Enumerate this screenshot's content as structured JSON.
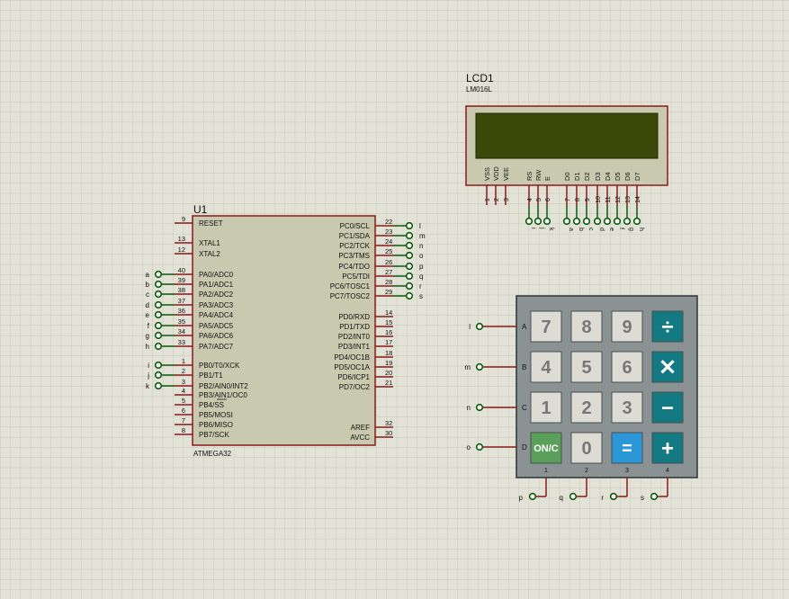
{
  "mcu": {
    "ref": "U1",
    "part": "ATMEGA32",
    "left_pins": [
      {
        "num": "9",
        "name": "RESET",
        "net": ""
      },
      {
        "num": "13",
        "name": "XTAL1",
        "net": ""
      },
      {
        "num": "12",
        "name": "XTAL2",
        "net": ""
      },
      {
        "num": "40",
        "name": "PA0/ADC0",
        "net": "a"
      },
      {
        "num": "39",
        "name": "PA1/ADC1",
        "net": "b"
      },
      {
        "num": "38",
        "name": "PA2/ADC2",
        "net": "c"
      },
      {
        "num": "37",
        "name": "PA3/ADC3",
        "net": "d"
      },
      {
        "num": "36",
        "name": "PA4/ADC4",
        "net": "e"
      },
      {
        "num": "35",
        "name": "PA5/ADC5",
        "net": "f"
      },
      {
        "num": "34",
        "name": "PA6/ADC6",
        "net": "g"
      },
      {
        "num": "33",
        "name": "PA7/ADC7",
        "net": "h"
      },
      {
        "num": "1",
        "name": "PB0/T0/XCK",
        "net": "i"
      },
      {
        "num": "2",
        "name": "PB1/T1",
        "net": "j"
      },
      {
        "num": "3",
        "name": "PB2/AIN0/INT2",
        "net": "k"
      },
      {
        "num": "4",
        "name": "PB3/AIN1/OC0",
        "net": ""
      },
      {
        "num": "5",
        "name": "PB4/SS",
        "net": ""
      },
      {
        "num": "6",
        "name": "PB5/MOSI",
        "net": ""
      },
      {
        "num": "7",
        "name": "PB6/MISO",
        "net": ""
      },
      {
        "num": "8",
        "name": "PB7/SCK",
        "net": ""
      }
    ],
    "right_pins": [
      {
        "num": "22",
        "name": "PC0/SCL",
        "net": "l"
      },
      {
        "num": "23",
        "name": "PC1/SDA",
        "net": "m"
      },
      {
        "num": "24",
        "name": "PC2/TCK",
        "net": "n"
      },
      {
        "num": "25",
        "name": "PC3/TMS",
        "net": "o"
      },
      {
        "num": "26",
        "name": "PC4/TDO",
        "net": "p"
      },
      {
        "num": "27",
        "name": "PC5/TDI",
        "net": "q"
      },
      {
        "num": "28",
        "name": "PC6/TOSC1",
        "net": "r"
      },
      {
        "num": "29",
        "name": "PC7/TOSC2",
        "net": "s"
      },
      {
        "num": "14",
        "name": "PD0/RXD",
        "net": ""
      },
      {
        "num": "15",
        "name": "PD1/TXD",
        "net": ""
      },
      {
        "num": "16",
        "name": "PD2/INT0",
        "net": ""
      },
      {
        "num": "17",
        "name": "PD3/INT1",
        "net": ""
      },
      {
        "num": "18",
        "name": "PD4/OC1B",
        "net": ""
      },
      {
        "num": "19",
        "name": "PD5/OC1A",
        "net": ""
      },
      {
        "num": "20",
        "name": "PD6/ICP1",
        "net": ""
      },
      {
        "num": "21",
        "name": "PD7/OC2",
        "net": ""
      },
      {
        "num": "32",
        "name": "AREF",
        "net": ""
      },
      {
        "num": "30",
        "name": "AVCC",
        "net": ""
      }
    ]
  },
  "lcd": {
    "ref": "LCD1",
    "part": "LM016L",
    "pins": [
      {
        "num": "1",
        "name": "VSS",
        "net": ""
      },
      {
        "num": "2",
        "name": "VDD",
        "net": ""
      },
      {
        "num": "3",
        "name": "VEE",
        "net": ""
      },
      {
        "num": "4",
        "name": "RS",
        "net": "i"
      },
      {
        "num": "5",
        "name": "RW",
        "net": "j"
      },
      {
        "num": "6",
        "name": "E",
        "net": "k"
      },
      {
        "num": "7",
        "name": "D0",
        "net": "a"
      },
      {
        "num": "8",
        "name": "D1",
        "net": "b"
      },
      {
        "num": "9",
        "name": "D2",
        "net": "c"
      },
      {
        "num": "10",
        "name": "D3",
        "net": "d"
      },
      {
        "num": "11",
        "name": "D4",
        "net": "e"
      },
      {
        "num": "12",
        "name": "D5",
        "net": "f"
      },
      {
        "num": "13",
        "name": "D6",
        "net": "g"
      },
      {
        "num": "14",
        "name": "D7",
        "net": "h"
      }
    ]
  },
  "keypad": {
    "rows": [
      {
        "label": "A",
        "net": "l"
      },
      {
        "label": "B",
        "net": "m"
      },
      {
        "label": "C",
        "net": "n"
      },
      {
        "label": "D",
        "net": "o"
      }
    ],
    "cols": [
      {
        "label": "1",
        "net": "p"
      },
      {
        "label": "2",
        "net": "q"
      },
      {
        "label": "3",
        "net": "r"
      },
      {
        "label": "4",
        "net": "s"
      }
    ],
    "keys": [
      [
        "7",
        "8",
        "9",
        "÷"
      ],
      [
        "4",
        "5",
        "6",
        "✕"
      ],
      [
        "1",
        "2",
        "3",
        "−"
      ],
      [
        "ON/C",
        "0",
        "=",
        "+"
      ]
    ]
  },
  "colors": {
    "background": "#e2e2d6",
    "grid": "#c9c9bd",
    "body_fill": "#c9c9af",
    "body_stroke": "#8b1a1a",
    "wire": "#8b1a1a",
    "terminal": "#0a5a0a",
    "lcd_screen": "#3b4a08",
    "keypad_body": "#8a9294",
    "key_grey": "#dcdcd4",
    "key_teal": "#137a84",
    "key_blue": "#2b97d6",
    "key_green": "#5aa05a"
  }
}
